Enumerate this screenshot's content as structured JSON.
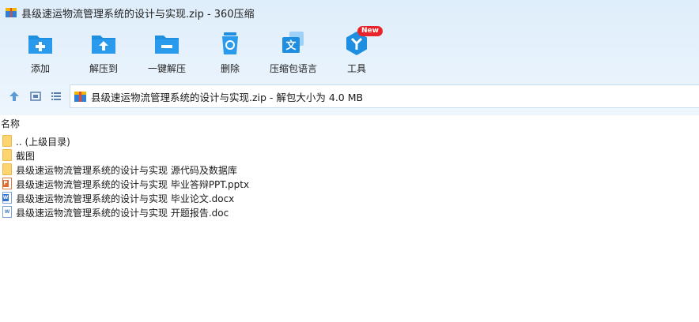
{
  "window": {
    "title": "县级速运物流管理系统的设计与实现.zip - 360压缩"
  },
  "toolbar": {
    "items": [
      {
        "label": "添加",
        "icon": "add-folder-icon"
      },
      {
        "label": "解压到",
        "icon": "extract-to-icon"
      },
      {
        "label": "一键解压",
        "icon": "one-click-extract-icon"
      },
      {
        "label": "删除",
        "icon": "recycle-bin-icon"
      },
      {
        "label": "压缩包语言",
        "icon": "archive-language-icon"
      },
      {
        "label": "工具",
        "icon": "tools-icon"
      }
    ],
    "new_badge": "New"
  },
  "nav": {
    "path": "县级速运物流管理系统的设计与实现.zip - 解包大小为 4.0 MB",
    "icons": [
      "up-arrow-icon",
      "thumbnail-view-icon",
      "list-view-icon"
    ]
  },
  "columns": {
    "name": "名称"
  },
  "files": [
    {
      "name": ".. (上级目录)",
      "type": "folder"
    },
    {
      "name": "截图",
      "type": "folder"
    },
    {
      "name": "县级速运物流管理系统的设计与实现 源代码及数据库",
      "type": "folder"
    },
    {
      "name": "县级速运物流管理系统的设计与实现 毕业答辩PPT.pptx",
      "type": "pptx"
    },
    {
      "name": "县级速运物流管理系统的设计与实现 毕业论文.docx",
      "type": "docx"
    },
    {
      "name": "县级速运物流管理系统的设计与实现 开题报告.doc",
      "type": "doc"
    }
  ],
  "colors": {
    "accent": "#1e8fe0",
    "badge": "#e8242a",
    "folder": "#fcd56e"
  }
}
